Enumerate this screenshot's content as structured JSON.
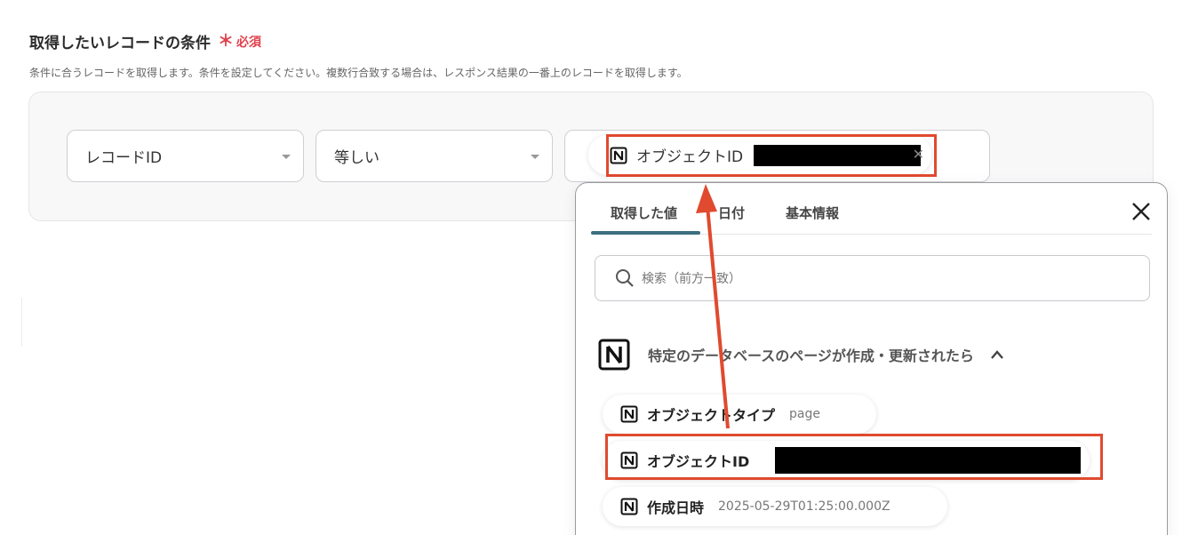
{
  "section": {
    "title": "取得したいレコードの条件",
    "required_mark": "＊",
    "required_label": "必須",
    "description": "条件に合うレコードを取得します。条件を設定してください。複数行合致する場合は、レスポンス結果の一番上のレコードを取得します。"
  },
  "condition": {
    "field": "レコードID",
    "operator": "等しい",
    "value_chip": {
      "label": "オブジェクトID",
      "remove": "✕"
    }
  },
  "popup": {
    "tabs": [
      {
        "label": "取得した値",
        "active": true
      },
      {
        "label": "日付",
        "active": false
      },
      {
        "label": "基本情報",
        "active": false
      }
    ],
    "search_placeholder": "検索（前方一致）",
    "group": {
      "title": "特定のデータベースのページが作成・更新されたら",
      "items": [
        {
          "name": "オブジェクトタイプ",
          "value": "page"
        },
        {
          "name": "オブジェクトID",
          "value": ""
        },
        {
          "name": "作成日時",
          "value": "2025-05-29T01:25:00.000Z"
        }
      ]
    }
  },
  "colors": {
    "highlight": "#e04a2f",
    "tab_accent": "#3c6e82",
    "required": "#e0424d"
  }
}
